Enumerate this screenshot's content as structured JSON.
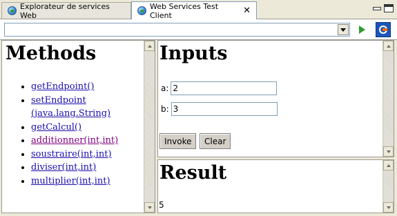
{
  "tabs": [
    {
      "label": "Explorateur de services Web",
      "active": false,
      "icon": "globe-icon"
    },
    {
      "label": "Web Services Test Client",
      "active": true,
      "icon": "globe-icon",
      "close_glyph": "✕"
    }
  ],
  "url_bar": {
    "value": ""
  },
  "methods": {
    "title": "Methods",
    "items": [
      {
        "label": "getEndpoint()"
      },
      {
        "label": "setEndpoint\n(java.lang.String)"
      },
      {
        "label": "getCalcul()"
      },
      {
        "label": "additionner(int,int)",
        "visited": true
      },
      {
        "label": "soustraire(int,int)"
      },
      {
        "label": "diviser(int,int)"
      },
      {
        "label": "multiplier(int,int)"
      }
    ]
  },
  "inputs": {
    "title": "Inputs",
    "fields": [
      {
        "label": "a:",
        "value": "2"
      },
      {
        "label": "b:",
        "value": "3"
      }
    ],
    "invoke_label": "Invoke",
    "clear_label": "Clear"
  },
  "result": {
    "title": "Result",
    "value": "5"
  },
  "colors": {
    "link": "#1a0dab",
    "visited_link": "#800080",
    "chrome": "#ece9d8",
    "accent": "#1d56b8"
  }
}
